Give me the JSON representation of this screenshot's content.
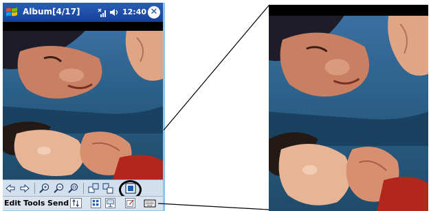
{
  "window": {
    "title": "Album[4/17]",
    "time": "12:40"
  },
  "icons": {
    "start": "windows-flag-icon",
    "connectivity": "antenna-icon",
    "volume": "speaker-icon",
    "close": "close-icon"
  },
  "toolbar": {
    "buttons": [
      "previous-arrow-icon",
      "next-arrow-icon",
      "zoom-in-icon",
      "zoom-out-icon",
      "zoom-fit-icon",
      "rotate-left-icon",
      "rotate-right-icon",
      "full-screen-icon"
    ]
  },
  "menubar": {
    "edit": "Edit",
    "tools": "Tools",
    "send": "Send"
  },
  "colors": {
    "titlebar": "#1a4ba6",
    "toolbar": "#d2e0ee",
    "frame": "#8ec6ea"
  }
}
